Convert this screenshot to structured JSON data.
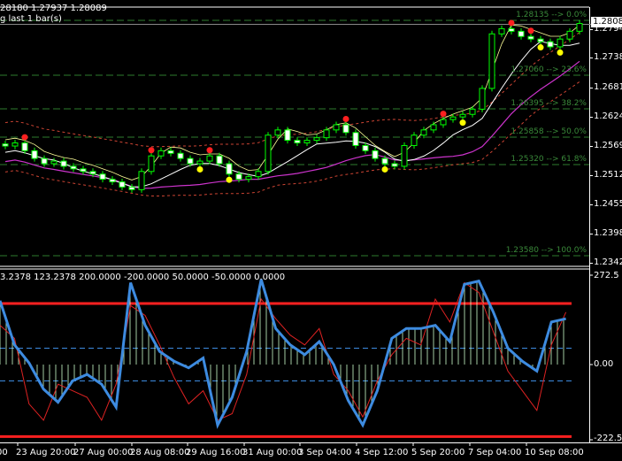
{
  "header": {
    "ohlc_text": "28180 1.27937 1.28089",
    "info_text": "g last 1 bar(s)",
    "indicator_text": "3.2378 123.2378 200.0000 -200.0000 50.0000 -50.0000 0.0000"
  },
  "price_axis": {
    "current_price": "1.28089",
    "labels": [
      "1.27940",
      "1.27385",
      "1.26815",
      "1.26245",
      "1.25690",
      "1.25120",
      "1.24550",
      "1.23980",
      "1.23425"
    ]
  },
  "indicator_axis": {
    "labels": [
      "272.5",
      "0.00",
      "-222.5"
    ]
  },
  "fib_levels": [
    {
      "price": 1.28135,
      "label": "1.28135 --> 0.0%"
    },
    {
      "price": 1.2706,
      "label": "1.27060 --> 23.6%"
    },
    {
      "price": 1.26395,
      "label": "1.26395 --> 38.2%"
    },
    {
      "price": 1.25858,
      "label": "1.25858 --> 50.0%"
    },
    {
      "price": 1.2532,
      "label": "1.25320 --> 61.8%"
    },
    {
      "price": 1.2358,
      "label": "1.23580 --> 100.0%"
    }
  ],
  "time_axis": [
    "00",
    "23 Aug 20:00",
    "27 Aug 00:00",
    "28 Aug 08:00",
    "29 Aug 16:00",
    "31 Aug 00:00",
    "3 Sep 04:00",
    "4 Sep 12:00",
    "5 Sep 20:00",
    "7 Sep 04:00",
    "10 Sep 08:00"
  ],
  "colors": {
    "bull": "#00ff00",
    "fib": "#2e7d2e",
    "ma_fast": "#ffff99",
    "ma_slow": "#ffffff",
    "ma_long": "#cc33cc",
    "envelope": "#cc4433",
    "cci": "#3d8be0",
    "signal": "#dd2222",
    "levels": "#ff2020"
  },
  "chart_data": {
    "type": "candlestick",
    "closes": [
      1.2569,
      1.2575,
      1.256,
      1.2545,
      1.2535,
      1.254,
      1.253,
      1.2525,
      1.252,
      1.2515,
      1.2505,
      1.25,
      1.249,
      1.2485,
      1.252,
      1.255,
      1.256,
      1.2555,
      1.2545,
      1.2535,
      1.254,
      1.255,
      1.2535,
      1.2515,
      1.2505,
      1.251,
      1.252,
      1.259,
      1.26,
      1.258,
      1.2575,
      1.258,
      1.2585,
      1.26,
      1.261,
      1.2595,
      1.257,
      1.256,
      1.2545,
      1.2535,
      1.253,
      1.257,
      1.259,
      1.26,
      1.261,
      1.262,
      1.2625,
      1.263,
      1.264,
      1.268,
      1.2785,
      1.2795,
      1.279,
      1.278,
      1.2775,
      1.277,
      1.276,
      1.2775,
      1.279,
      1.2805
    ],
    "red_dots": [
      2,
      15,
      21,
      35,
      45,
      52,
      54
    ],
    "yellow_dots": [
      20,
      23,
      39,
      47,
      55,
      57
    ],
    "ylim": [
      1.233,
      1.285
    ],
    "indicator": {
      "name": "CCI",
      "levels": [
        200,
        50,
        0,
        -50,
        -200
      ],
      "ylim": [
        -240,
        290
      ],
      "cci": [
        195,
        60,
        5,
        -75,
        -115,
        -50,
        -30,
        -60,
        -130,
        250,
        120,
        40,
        10,
        -10,
        20,
        -185,
        -100,
        40,
        260,
        110,
        60,
        30,
        70,
        0,
        -110,
        -185,
        -80,
        80,
        110,
        110,
        120,
        70,
        245,
        255,
        160,
        50,
        10,
        -20,
        130,
        140
      ],
      "signal": [
        120,
        80,
        -120,
        -170,
        -60,
        -80,
        -100,
        -170,
        -60,
        180,
        150,
        60,
        -40,
        -120,
        -80,
        -170,
        -150,
        -30,
        200,
        140,
        90,
        60,
        110,
        -30,
        -80,
        -160,
        -50,
        30,
        80,
        60,
        200,
        130,
        250,
        220,
        100,
        -20,
        -80,
        -140,
        60,
        160
      ]
    }
  }
}
